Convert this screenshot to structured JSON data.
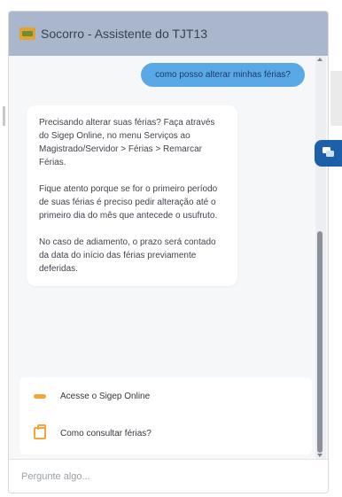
{
  "header": {
    "title": "Socorro - Assistente do TJT13",
    "icon": "chat-icon"
  },
  "conversation": {
    "user_message": "como posso alterar minhas férias?",
    "bot_paragraphs": [
      "Precisando alterar suas férias? Faça através do Sigep Online, no menu Serviços ao Magistrado/Servidor > Férias > Remarcar Férias.",
      "Fique atento porque se for o primeiro período de suas férias é preciso pedir alteração até o primeiro dia do mês que antecede o usufruto.",
      "No caso de adiamento, o prazo será contado da data do início das férias previamente deferidas."
    ]
  },
  "suggestions": [
    {
      "label": "Acesse o Sigep Online",
      "icon": "link-icon"
    },
    {
      "label": "Como consultar férias?",
      "icon": "briefcase-icon"
    }
  ],
  "input": {
    "placeholder": "Pergunte algo..."
  },
  "colors": {
    "header_bg": "#a9b6cc",
    "user_bubble": "#5aa9e6",
    "accent_orange": "#f2a63b",
    "side_button": "#1d5fa8"
  }
}
